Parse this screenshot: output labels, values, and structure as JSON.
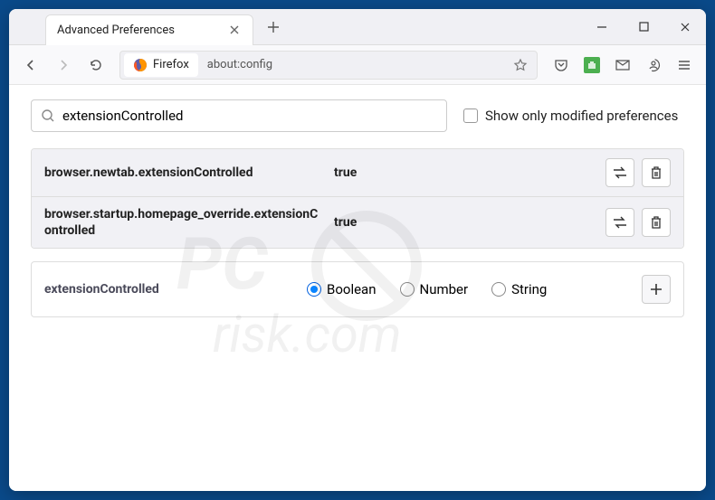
{
  "tab": {
    "title": "Advanced Preferences"
  },
  "urlbar": {
    "identity": "Firefox",
    "url": "about:config"
  },
  "search": {
    "value": "extensionControlled",
    "checkbox_label": "Show only modified preferences"
  },
  "prefs": [
    {
      "name": "browser.newtab.extensionControlled",
      "value": "true"
    },
    {
      "name": "browser.startup.homepage_override.extensionControlled",
      "value": "true"
    }
  ],
  "new_pref": {
    "name": "extensionControlled",
    "types": [
      {
        "label": "Boolean",
        "checked": true
      },
      {
        "label": "Number",
        "checked": false
      },
      {
        "label": "String",
        "checked": false
      }
    ]
  }
}
